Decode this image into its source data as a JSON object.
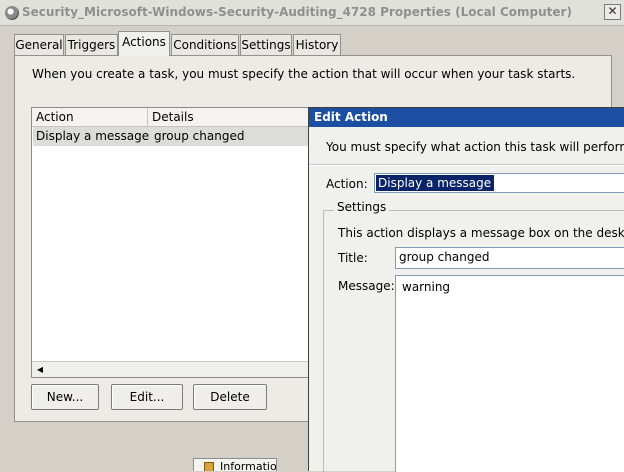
{
  "window": {
    "title": "Security_Microsoft-Windows-Security-Auditing_4728 Properties (Local Computer)",
    "close_glyph": "✕"
  },
  "tabs": [
    {
      "label": "General"
    },
    {
      "label": "Triggers"
    },
    {
      "label": "Actions",
      "active": true
    },
    {
      "label": "Conditions"
    },
    {
      "label": "Settings"
    },
    {
      "label": "History"
    }
  ],
  "actions_panel": {
    "description": "When you create a task, you must specify the action that will occur when your task starts.",
    "columns": [
      "Action",
      "Details"
    ],
    "rows": [
      {
        "action": "Display a message",
        "details": "group changed"
      }
    ],
    "scroll_left_glyph": "◀",
    "buttons": {
      "new": "New...",
      "edit": "Edit...",
      "delete": "Delete"
    }
  },
  "edit_action": {
    "title": "Edit Action",
    "description": "You must specify what action this task will perform.",
    "action_label": "Action:",
    "action_value": "Display a message",
    "settings_label": "Settings",
    "settings_description": "This action displays a message box on the desktop.",
    "title_label": "Title:",
    "title_value": "group changed",
    "message_label": "Message:",
    "message_value": "warning"
  },
  "background_window": {
    "text": "Information"
  },
  "colors": {
    "dialog_titlebar": "#1c4ea2",
    "selection": "#0a246a",
    "window_bg": "#d4d0c8"
  }
}
